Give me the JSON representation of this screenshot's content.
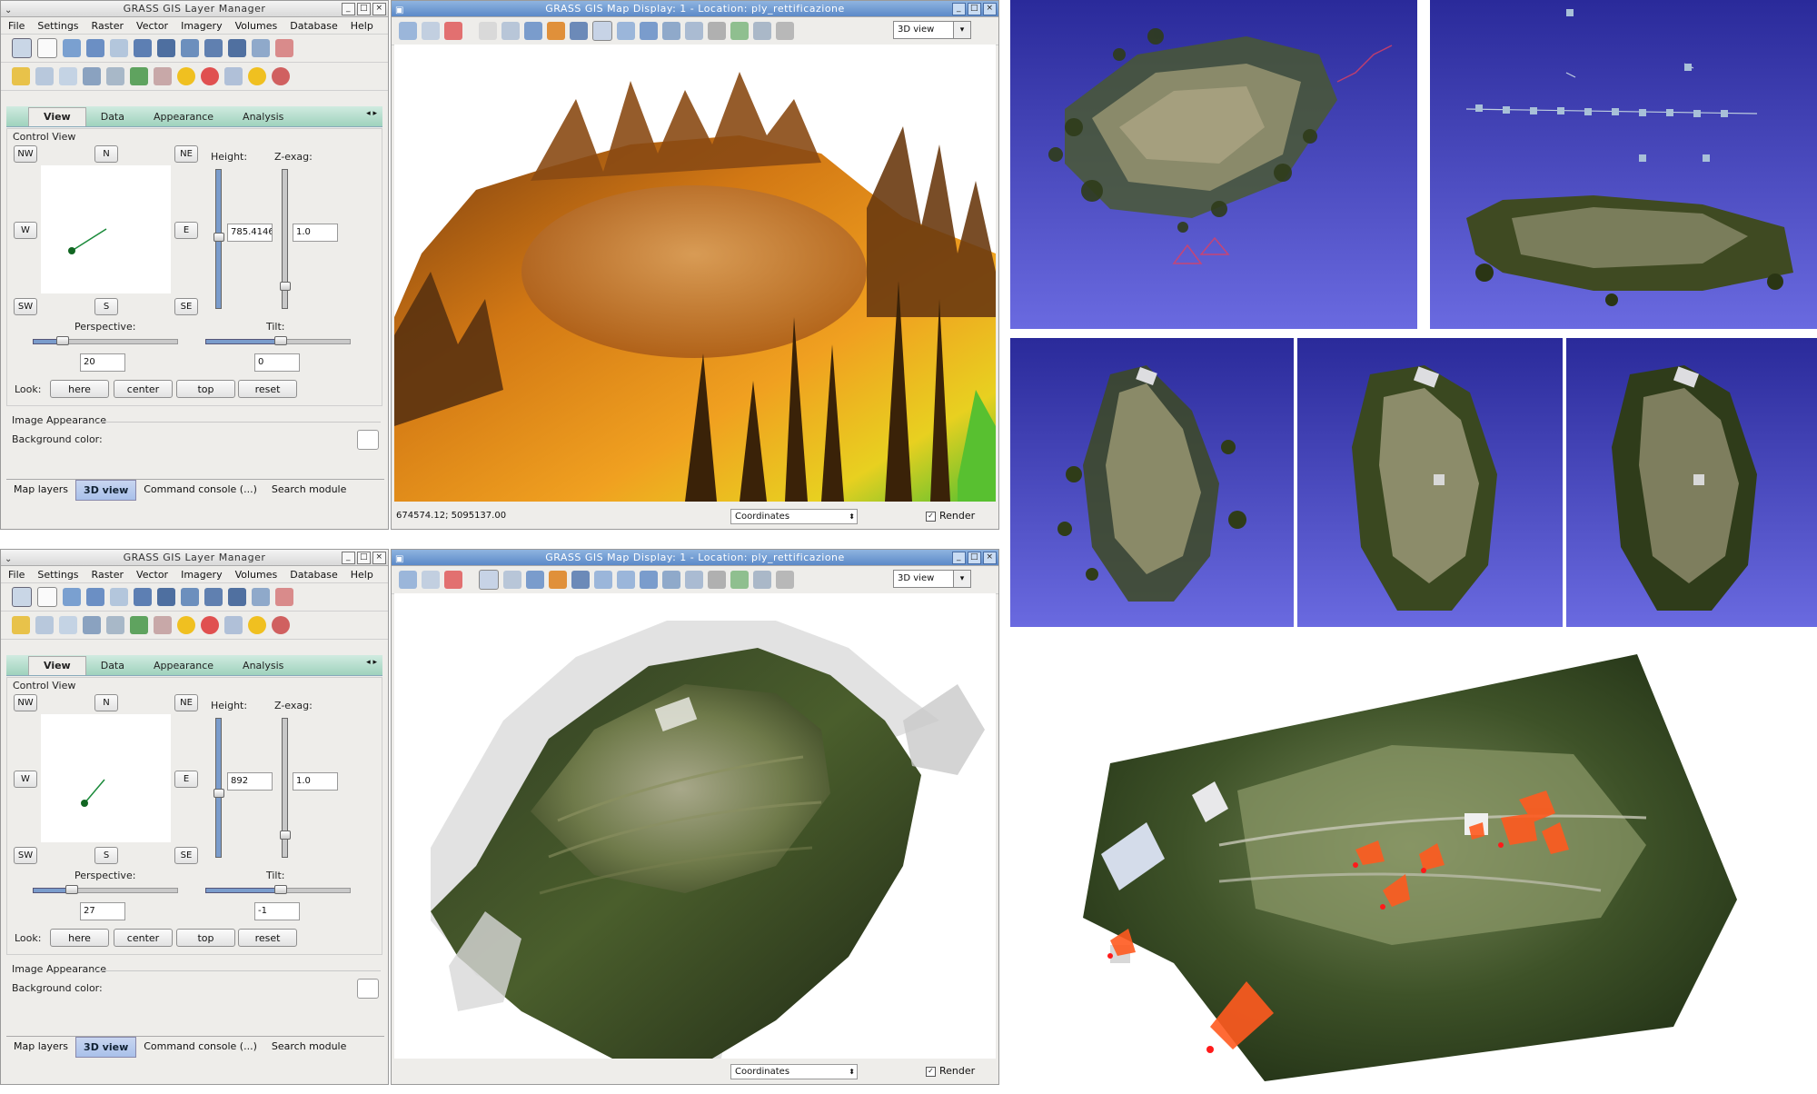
{
  "layer_manager": {
    "title": "GRASS GIS Layer Manager",
    "menu": [
      "File",
      "Settings",
      "Raster",
      "Vector",
      "Imagery",
      "Volumes",
      "Database",
      "Help"
    ],
    "tabs": [
      "View",
      "Data",
      "Appearance",
      "Analysis"
    ],
    "active_tab": "View",
    "control_view_label": "Control View",
    "directions": {
      "nw": "NW",
      "n": "N",
      "ne": "NE",
      "w": "W",
      "e": "E",
      "sw": "SW",
      "s": "S",
      "se": "SE"
    },
    "height_label": "Height:",
    "zexag_label": "Z-exag:",
    "perspective_label": "Perspective:",
    "tilt_label": "Tilt:",
    "look_label": "Look:",
    "look_buttons": [
      "here",
      "center",
      "top",
      "reset"
    ],
    "image_appearance_label": "Image Appearance",
    "background_color_label": "Background color:",
    "bottom_tabs": [
      "Map layers",
      "3D view",
      "Command console (...)",
      "Search module"
    ],
    "active_bottom_tab": "3D view"
  },
  "map_display": {
    "title": "GRASS GIS Map Display: 1  - Location: ply_rettificazione",
    "view_mode": "3D view",
    "coordinates_label": "Coordinates",
    "render_label": "Render"
  },
  "windows": [
    {
      "height": "785.4146",
      "zexag": "1.0",
      "perspective": "20",
      "tilt": "0",
      "coordinates_readout": "674574.12; 5095137.00"
    },
    {
      "height": "892",
      "zexag": "1.0",
      "perspective": "27",
      "tilt": "-1",
      "coordinates_readout": ""
    }
  ],
  "colors": {
    "tab_green": "#9fd2bd",
    "window_bg": "#eeedea",
    "title_blue": "#5b89c8",
    "purple_bg": "#5a5ad2",
    "dem_orange": "#e88a18",
    "marker_red": "#ff5a1f"
  }
}
